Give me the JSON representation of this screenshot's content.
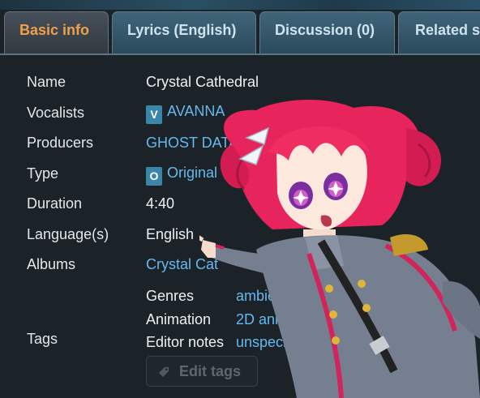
{
  "tabs": [
    {
      "label": "Basic info",
      "active": true
    },
    {
      "label": "Lyrics (English)",
      "active": false
    },
    {
      "label": "Discussion (0)",
      "active": false
    },
    {
      "label": "Related s",
      "active": false
    }
  ],
  "info": {
    "name_label": "Name",
    "name_value": "Crystal Cathedral",
    "vocalists_label": "Vocalists",
    "vocalists_badge": "V",
    "vocalists_value": "AVANNA",
    "producers_label": "Producers",
    "producers_value": "GHOST DATA",
    "type_label": "Type",
    "type_badge": "O",
    "type_value": "Original",
    "duration_label": "Duration",
    "duration_value": "4:40",
    "language_label": "Language(s)",
    "language_value": "English",
    "albums_label": "Albums",
    "albums_value": "Crystal Cat"
  },
  "tags": {
    "label": "Tags",
    "rows": [
      {
        "name": "Genres",
        "value": "ambie"
      },
      {
        "name": "Animation",
        "value": "2D anima"
      },
      {
        "name": "Editor notes",
        "value": "unspecified"
      }
    ],
    "edit_button": "Edit tags"
  },
  "icons": {
    "edit_tags": "tag-icon",
    "mascot": "mascot-character"
  },
  "colors": {
    "accent": "#f0a04b",
    "link": "#66b8ef",
    "badge": "#3a86a8",
    "background": "#1b2329"
  }
}
